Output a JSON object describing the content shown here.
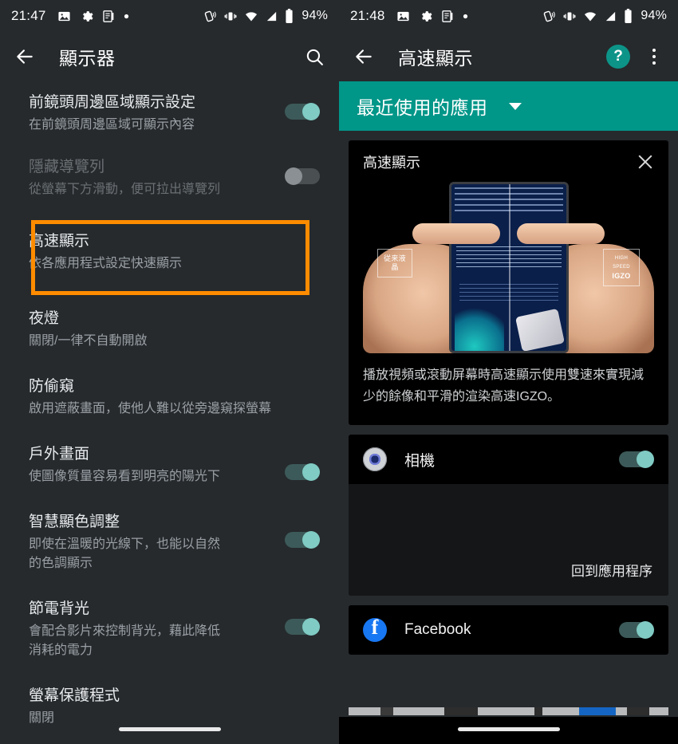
{
  "left": {
    "statusbar": {
      "time": "21:47",
      "battery": "94%",
      "left_icons": [
        "image-icon",
        "gear-icon",
        "document-icon",
        "dot-icon"
      ],
      "right_icons": [
        "nfc-icon",
        "vibrate-icon",
        "wifi-icon",
        "signal-icon",
        "battery-icon"
      ]
    },
    "appbar": {
      "back": "back-arrow-icon",
      "title": "顯示器",
      "search": "search-icon"
    },
    "items": [
      {
        "title": "前鏡頭周邊區域顯示設定",
        "sub": "在前鏡頭周邊區域可顯示內容",
        "toggle": "on",
        "disabled": false
      },
      {
        "title": "隱藏導覽列",
        "sub": "從螢幕下方滑動，便可拉出導覽列",
        "toggle": "off",
        "disabled": true
      },
      {
        "title": "高速顯示",
        "sub": "依各應用程式設定快速顯示",
        "toggle": "none",
        "disabled": false,
        "highlighted": true
      },
      {
        "title": "夜燈",
        "sub": "關閉/一律不自動開啟",
        "toggle": "none",
        "disabled": false
      },
      {
        "title": "防偷窺",
        "sub": "啟用遮蔽畫面，使他人難以從旁邊窺探螢幕",
        "toggle": "none",
        "disabled": false
      },
      {
        "title": "戶外畫面",
        "sub": "使圖像質量容易看到明亮的陽光下",
        "toggle": "on",
        "disabled": false
      },
      {
        "title": "智慧顯色調整",
        "sub": "即使在溫暖的光線下，也能以自然的色調顯示",
        "toggle": "on",
        "disabled": false
      },
      {
        "title": "節電背光",
        "sub": "會配合影片來控制背光，藉此降低消耗的電力",
        "toggle": "on",
        "disabled": false
      },
      {
        "title": "螢幕保護程式",
        "sub": "關閉",
        "toggle": "none",
        "disabled": false
      }
    ]
  },
  "right": {
    "statusbar": {
      "time": "21:48",
      "battery": "94%",
      "left_icons": [
        "image-icon",
        "gear-icon",
        "document-icon",
        "dot-icon"
      ],
      "right_icons": [
        "nfc-icon",
        "vibrate-icon",
        "wifi-icon",
        "signal-icon",
        "battery-icon"
      ]
    },
    "appbar": {
      "back": "back-arrow-icon",
      "title": "高速顯示",
      "help": "?",
      "overflow": "overflow-menu-icon"
    },
    "filter": {
      "label": "最近使用的應用",
      "caret": "chevron-down-icon"
    },
    "info_card": {
      "title": "高速顯示",
      "close": "close-icon",
      "body": "播放視頻或滾動屏幕時高速顯示使用雙速來實現減少的餘像和平滑的渲染高速IGZO。",
      "image_tag_left": "従来液晶",
      "image_tag_right_small": "HIGH SPEED",
      "image_tag_right": "IGZO"
    },
    "apps": [
      {
        "name": "相機",
        "icon": "camera-icon",
        "toggle": "on"
      },
      {
        "name": "Facebook",
        "icon": "facebook-icon",
        "toggle": "on"
      }
    ],
    "back_to_app": "回到應用程序"
  },
  "colors": {
    "accent_teal": "#009688",
    "toggle_on_thumb": "#80cbc4",
    "toggle_on_track": "#3c5a59",
    "highlight_orange": "#ff8c00",
    "panel_bg": "#262a2d",
    "card_bg": "#000000"
  }
}
